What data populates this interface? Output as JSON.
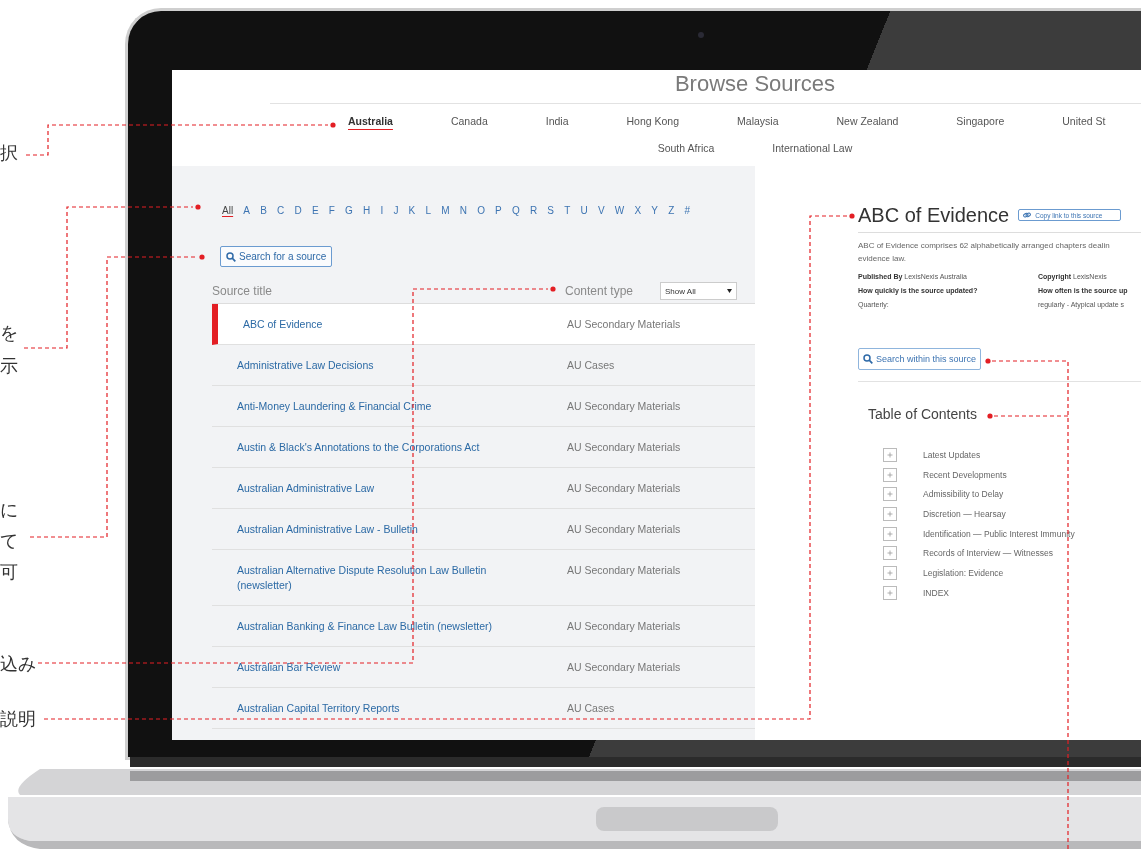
{
  "callouts": [
    {
      "lines": [
        "択"
      ]
    },
    {
      "lines": [
        "を",
        "示"
      ]
    },
    {
      "lines": [
        "に",
        "て",
        "可"
      ]
    },
    {
      "lines": [
        "込み"
      ]
    },
    {
      "lines": [
        "説明"
      ]
    }
  ],
  "screen": {
    "title": "Browse Sources",
    "region_rows": [
      {
        "items": [
          {
            "label": "Australia",
            "selected": true
          },
          {
            "label": "Canada",
            "selected": false
          },
          {
            "label": "India",
            "selected": false
          },
          {
            "label": "Hong Kong",
            "selected": false
          },
          {
            "label": "Malaysia",
            "selected": false
          },
          {
            "label": "New Zealand",
            "selected": false
          },
          {
            "label": "Singapore",
            "selected": false
          },
          {
            "label": "United St",
            "selected": false
          }
        ]
      },
      {
        "items": [
          {
            "label": "South Africa",
            "selected": false
          },
          {
            "label": "International Law",
            "selected": false
          }
        ]
      }
    ],
    "alphabet": [
      {
        "label": "All",
        "selected": true
      },
      {
        "label": "A",
        "selected": false
      },
      {
        "label": "B",
        "selected": false
      },
      {
        "label": "C",
        "selected": false
      },
      {
        "label": "D",
        "selected": false
      },
      {
        "label": "E",
        "selected": false
      },
      {
        "label": "F",
        "selected": false
      },
      {
        "label": "G",
        "selected": false
      },
      {
        "label": "H",
        "selected": false
      },
      {
        "label": "I",
        "selected": false
      },
      {
        "label": "J",
        "selected": false
      },
      {
        "label": "K",
        "selected": false
      },
      {
        "label": "L",
        "selected": false
      },
      {
        "label": "M",
        "selected": false
      },
      {
        "label": "N",
        "selected": false
      },
      {
        "label": "O",
        "selected": false
      },
      {
        "label": "P",
        "selected": false
      },
      {
        "label": "Q",
        "selected": false
      },
      {
        "label": "R",
        "selected": false
      },
      {
        "label": "S",
        "selected": false
      },
      {
        "label": "T",
        "selected": false
      },
      {
        "label": "U",
        "selected": false
      },
      {
        "label": "V",
        "selected": false
      },
      {
        "label": "W",
        "selected": false
      },
      {
        "label": "X",
        "selected": false
      },
      {
        "label": "Y",
        "selected": false
      },
      {
        "label": "Z",
        "selected": false
      },
      {
        "label": "#",
        "selected": false
      }
    ],
    "search_button": "Search for a source",
    "table": {
      "columns": [
        "Source title",
        "Content type"
      ],
      "filter": {
        "value": "Show All"
      },
      "rows": [
        {
          "title": "ABC of Evidence",
          "content_type": "AU Secondary Materials",
          "selected": true
        },
        {
          "title": "Administrative Law Decisions",
          "content_type": "AU Cases",
          "selected": false
        },
        {
          "title": "Anti-Money Laundering & Financial Crime",
          "content_type": "AU Secondary Materials",
          "selected": false
        },
        {
          "title": "Austin & Black's Annotations to the Corporations Act",
          "content_type": "AU Secondary Materials",
          "selected": false
        },
        {
          "title": "Australian Administrative Law",
          "content_type": "AU Secondary Materials",
          "selected": false
        },
        {
          "title": "Australian Administrative Law - Bulletin",
          "content_type": "AU Secondary Materials",
          "selected": false
        },
        {
          "title": "Australian Alternative Dispute Resolution Law Bulletin (newsletter)",
          "content_type": "AU Secondary Materials",
          "selected": false
        },
        {
          "title": "Australian Banking & Finance Law Bulletin (newsletter)",
          "content_type": "AU Secondary Materials",
          "selected": false
        },
        {
          "title": "Australian Bar Review",
          "content_type": "AU Secondary Materials",
          "selected": false
        },
        {
          "title": "Australian Capital Territory Reports",
          "content_type": "AU Cases",
          "selected": false
        }
      ]
    },
    "detail": {
      "title": "ABC of Evidence",
      "copy_link": "Copy link to this source",
      "description": "ABC of Evidence comprises 62 alphabetically arranged chapters dealin\nevidence law.",
      "columns": [
        {
          "label": "Published By",
          "value": "LexisNexis Australia",
          "question": "How quickly is the source updated?",
          "answer": "Quarterly:"
        },
        {
          "label": "Copyright",
          "value": "LexisNexis",
          "question": "How often is the source up",
          "answer": "regularly - Atypical update s"
        }
      ],
      "search_button": "Search within this source",
      "toc": {
        "title": "Table of Contents",
        "items": [
          {
            "label": "Latest Updates",
            "expanded": false
          },
          {
            "label": "Recent Developments",
            "expanded": false
          },
          {
            "label": "Admissibility to Delay",
            "expanded": false
          },
          {
            "label": "Discretion — Hearsay",
            "expanded": false
          },
          {
            "label": "Identification — Public Interest Immunity",
            "expanded": false
          },
          {
            "label": "Records of Interview — Witnesses",
            "expanded": false
          },
          {
            "label": "Legislation: Evidence",
            "expanded": false
          },
          {
            "label": "INDEX",
            "expanded": false
          }
        ]
      }
    }
  }
}
